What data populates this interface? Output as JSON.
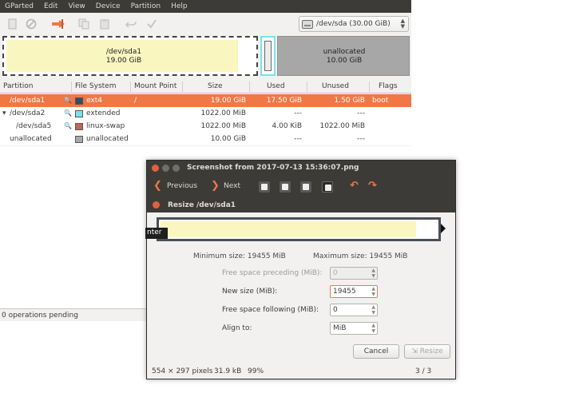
{
  "gparted": {
    "menu": [
      "GParted",
      "Edit",
      "View",
      "Device",
      "Partition",
      "Help"
    ],
    "toolbar_icons": [
      "new-icon",
      "delete-icon",
      "resize-move-icon",
      "copy-icon",
      "paste-icon",
      "undo-icon",
      "apply-icon"
    ],
    "device": {
      "label": "/dev/sda  (30.00 GiB)"
    },
    "disk_map": {
      "sda1": {
        "name": "/dev/sda1",
        "size": "19.00 GiB"
      },
      "unallocated": {
        "name": "unallocated",
        "size": "10.00 GiB"
      }
    },
    "columns": [
      "Partition",
      "File System",
      "Mount Point",
      "Size",
      "Used",
      "Unused",
      "Flags"
    ],
    "rows": [
      {
        "partition": "/dev/sda1",
        "filesystem": "ext4",
        "mount": "/",
        "size": "19.00 GiB",
        "used": "17.50 GiB",
        "unused": "1.50 GiB",
        "flags": "boot",
        "color": "#314e6c"
      },
      {
        "partition": "/dev/sda2",
        "filesystem": "extended",
        "mount": "",
        "size": "1022.00 MiB",
        "used": "---",
        "unused": "---",
        "flags": "",
        "color": "#7fe0ec"
      },
      {
        "partition": "/dev/sda5",
        "filesystem": "linux-swap",
        "mount": "",
        "size": "1022.00 MiB",
        "used": "4.00 KiB",
        "unused": "1022.00 MiB",
        "flags": "",
        "color": "#c1665a"
      },
      {
        "partition": "unallocated",
        "filesystem": "unallocated",
        "mount": "",
        "size": "10.00 GiB",
        "used": "---",
        "unused": "---",
        "flags": "",
        "color": "#a9a9a9"
      }
    ],
    "status": "0 operations pending"
  },
  "viewer": {
    "title": "Screenshot from 2017-07-13 15:36:07.png",
    "previous": "Previous",
    "next": "Next",
    "footer": {
      "dimensions": "554 × 297 pixels",
      "filesize": "31.9 kB",
      "zoom": "99%",
      "position": "3 / 3"
    }
  },
  "dialog": {
    "title": "Resize /dev/sda1",
    "tooltip": "nter",
    "min_size": "Minimum size: 19455 MiB",
    "max_size": "Maximum size: 19455 MiB",
    "fields": {
      "preceding": {
        "label": "Free space preceding (MiB):",
        "value": "0"
      },
      "new_size": {
        "label": "New size (MiB):",
        "value": "19455"
      },
      "following": {
        "label": "Free space following (MiB):",
        "value": "0"
      },
      "align": {
        "label": "Align to:",
        "value": "MiB"
      }
    },
    "cancel": "Cancel",
    "resize": "Resize"
  },
  "colors": {
    "accent": "#f07746",
    "titlebar": "#3c3b37",
    "ext4": "#314e6c",
    "extended": "#7fe0ec",
    "swap": "#c1665a",
    "unallocated": "#a9a9a9",
    "sda1_fill": "#faf6c0"
  }
}
